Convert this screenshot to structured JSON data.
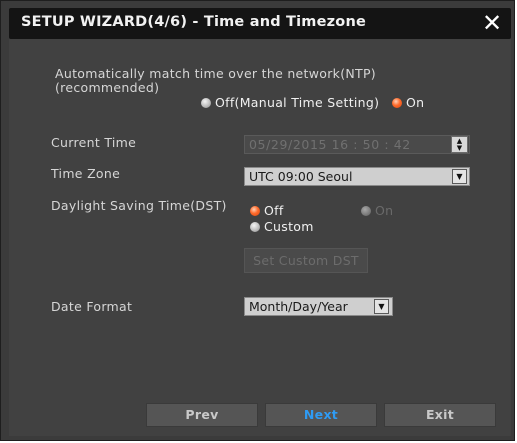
{
  "window": {
    "title": "SETUP WIZARD(4/6) - Time and Timezone",
    "close_symbol": "✕"
  },
  "ntp": {
    "label": "Automatically match time over the network(NTP)\n(recommended)",
    "options": [
      {
        "label": "Off(Manual Time Setting)",
        "selected": false
      },
      {
        "label": "On",
        "selected": true
      }
    ]
  },
  "current_time": {
    "label": "Current Time",
    "value": "05/29/2015  16 : 50 : 42"
  },
  "time_zone": {
    "label": "Time Zone",
    "value": "UTC 09:00 Seoul"
  },
  "dst": {
    "label": "Daylight Saving Time(DST)",
    "options": [
      {
        "label": "Off",
        "selected": true,
        "enabled": true
      },
      {
        "label": "On",
        "selected": false,
        "enabled": false
      },
      {
        "label": "Custom",
        "selected": false,
        "enabled": true
      }
    ],
    "set_custom_button": "Set Custom DST"
  },
  "date_format": {
    "label": "Date Format",
    "value": "Month/Day/Year"
  },
  "nav": {
    "prev": "Prev",
    "next": "Next",
    "exit": "Exit"
  },
  "colors": {
    "accent_selected": "#ff6a2a",
    "next_text": "#2f9bf3"
  }
}
